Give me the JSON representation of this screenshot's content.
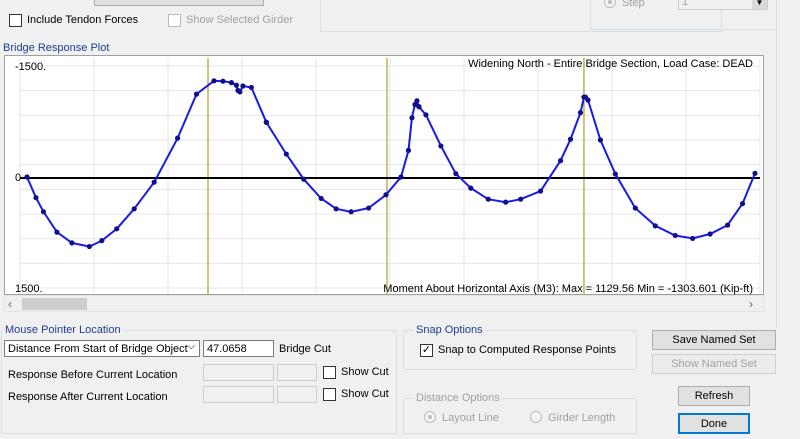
{
  "top": {
    "include_tendon_forces": {
      "label": "Include Tendon Forces",
      "checked": false
    },
    "show_selected_girder": {
      "label": "Show Selected Girder",
      "checked": false
    },
    "step_label": "Step",
    "step_value": "1"
  },
  "plot": {
    "title": "Bridge Response Plot",
    "heading": "Widening North - Entire Bridge Section,  Load Case: DEAD",
    "y_top_label": "-1500.",
    "y_bottom_label": "1500.",
    "zero_label": "0",
    "footer": "Moment About Horizontal Axis  (M3):  Max = 1129.56    Min = -1303.601   (Kip-ft)"
  },
  "chart_data": {
    "type": "line",
    "title": "Widening North - Entire Bridge Section,  Load Case: DEAD",
    "ylabel": "Moment About Horizontal Axis  (M3)",
    "units": "Kip-ft",
    "ylim": [
      1500,
      -1500
    ],
    "y_inverted": true,
    "line_color": "#1a1ae6",
    "spans": [
      {
        "name": "span-1",
        "x": [
          0,
          0.018,
          0.033,
          0.06,
          0.09,
          0.125,
          0.15,
          0.18,
          0.215,
          0.255,
          0.302,
          0.34,
          0.375,
          0.393,
          0.41,
          0.42,
          0.423,
          0.427,
          0.433,
          0.45,
          0.48
        ],
        "y": [
          0,
          280,
          470,
          745,
          890,
          940,
          860,
          700,
          430,
          70,
          -525,
          -1120,
          -1300,
          -1295,
          -1275,
          -1240,
          -1170,
          -1150,
          -1230,
          -1210,
          -740
        ]
      },
      {
        "name": "span-2",
        "x": [
          0.48,
          0.52,
          0.555,
          0.59,
          0.62,
          0.65,
          0.685,
          0.72,
          0.75,
          0.765,
          0.772,
          0.778,
          0.782,
          0.786
        ],
        "y": [
          -740,
          -310,
          30,
          290,
          430,
          470,
          420,
          240,
          0,
          -360,
          -800,
          -980,
          -1030,
          -950
        ]
      },
      {
        "name": "span-3",
        "x": [
          0.786,
          0.8,
          0.83,
          0.86,
          0.89,
          0.925,
          0.96,
          0.99,
          1.03,
          1.07,
          1.09,
          1.11,
          1.117,
          1.12,
          1.125
        ],
        "y": [
          -950,
          -840,
          -420,
          -45,
          150,
          300,
          340,
          300,
          190,
          -220,
          -510,
          -870,
          -1080,
          -1080,
          -1040
        ]
      },
      {
        "name": "span-4",
        "x": [
          1.125,
          1.15,
          1.18,
          1.22,
          1.26,
          1.3,
          1.335,
          1.37,
          1.405,
          1.435,
          1.46
        ],
        "y": [
          -1040,
          -500,
          -40,
          420,
          660,
          790,
          830,
          770,
          650,
          360,
          -50
        ]
      }
    ],
    "support_lines": [
      0.363,
      0.722,
      1.117
    ]
  },
  "mouse": {
    "title": "Mouse Pointer Location",
    "dropdown_value": "Distance From Start of Bridge Object",
    "distance_value": "47.0658",
    "bridge_cut_label": "Bridge Cut",
    "response_before": "Response Before Current Location",
    "response_after": "Response After Current Location",
    "show_cut_label": "Show Cut"
  },
  "snap": {
    "title": "Snap Options",
    "snap_label": "Snap to Computed Response Points",
    "checked": true
  },
  "distance": {
    "title": "Distance Options",
    "layout_line": "Layout Line",
    "girder_length": "Girder Length"
  },
  "buttons": {
    "save_named_set": "Save Named Set",
    "show_named_set": "Show Named Set",
    "refresh": "Refresh",
    "done": "Done"
  }
}
